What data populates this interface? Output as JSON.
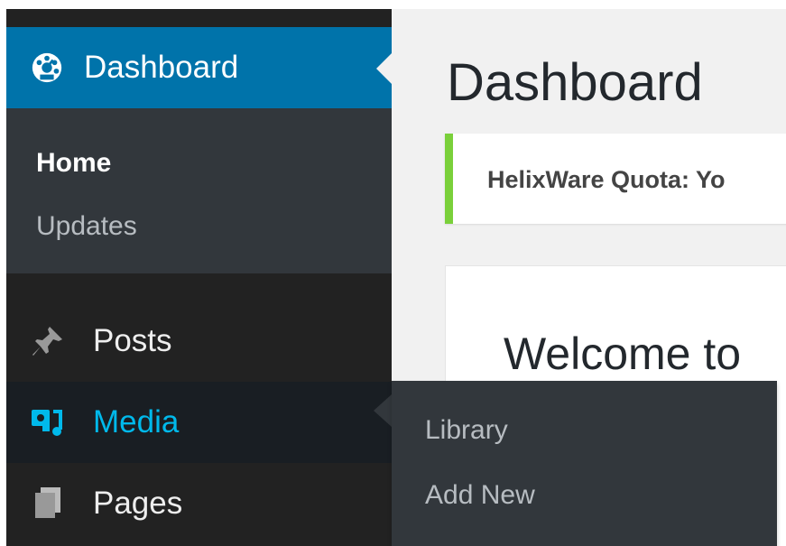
{
  "sidebar": {
    "dashboard": {
      "label": "Dashboard",
      "icon": "dashboard-gauge-icon"
    },
    "dashboard_submenu": [
      {
        "label": "Home",
        "current": true
      },
      {
        "label": "Updates",
        "current": false
      }
    ],
    "items": [
      {
        "label": "Posts",
        "icon": "pin-icon"
      },
      {
        "label": "Media",
        "icon": "media-icon",
        "hover": true
      },
      {
        "label": "Pages",
        "icon": "pages-icon"
      }
    ]
  },
  "media_flyout": {
    "items": [
      {
        "label": "Library"
      },
      {
        "label": "Add New"
      }
    ]
  },
  "main": {
    "title": "Dashboard",
    "notice": "HelixWare Quota: Yo",
    "welcome_title": "Welcome to"
  },
  "colors": {
    "sidebar_bg": "#222222",
    "active_bg": "#0073aa",
    "submenu_bg": "#32373c",
    "hover_text": "#00b9eb",
    "notice_border": "#7ad03a",
    "content_bg": "#f1f1f1"
  }
}
